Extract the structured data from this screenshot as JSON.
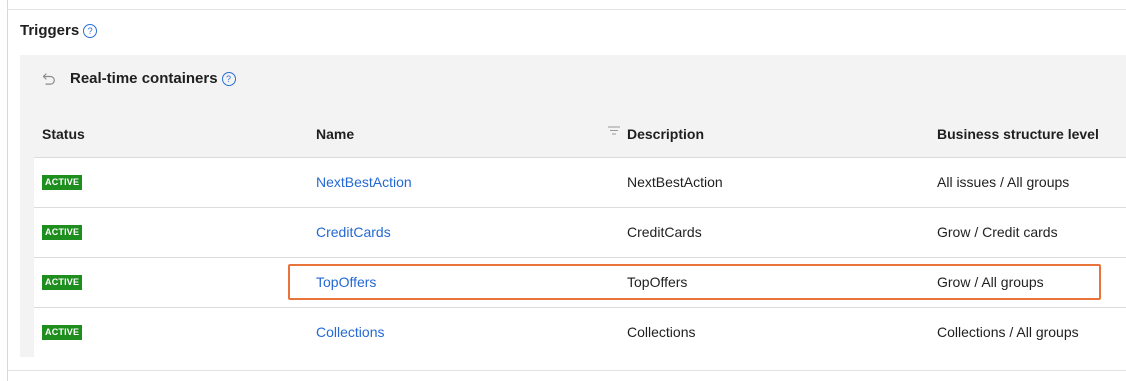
{
  "section": {
    "title": "Triggers"
  },
  "panel": {
    "title": "Real-time containers"
  },
  "table": {
    "headers": {
      "status": "Status",
      "name": "Name",
      "description": "Description",
      "level": "Business structure level"
    },
    "rows": [
      {
        "status": "ACTIVE",
        "name": "NextBestAction",
        "description": "NextBestAction",
        "level": "All issues / All groups"
      },
      {
        "status": "ACTIVE",
        "name": "CreditCards",
        "description": "CreditCards",
        "level": "Grow / Credit cards"
      },
      {
        "status": "ACTIVE",
        "name": "TopOffers",
        "description": "TopOffers",
        "level": "Grow / All groups"
      },
      {
        "status": "ACTIVE",
        "name": "Collections",
        "description": "Collections",
        "level": "Collections / All groups"
      }
    ]
  },
  "colors": {
    "badge": "#1e8e1e",
    "link": "#2469d3",
    "highlight": "#e8743b"
  },
  "icons": {
    "help": "help-circle-icon",
    "back": "undo-arrow-icon",
    "filter": "filter-icon"
  }
}
